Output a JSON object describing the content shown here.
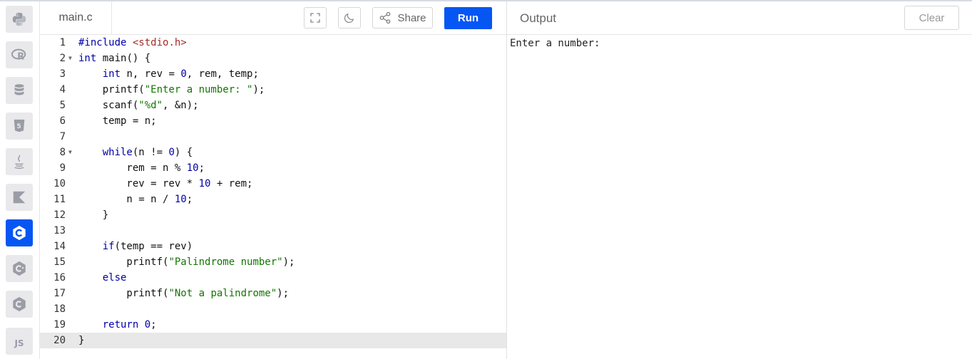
{
  "tab": {
    "filename": "main.c"
  },
  "toolbar": {
    "share_label": "Share",
    "run_label": "Run"
  },
  "output": {
    "title": "Output",
    "clear_label": "Clear",
    "text": "Enter a number:"
  },
  "sidebar": {
    "items": [
      {
        "name": "python-icon"
      },
      {
        "name": "r-icon"
      },
      {
        "name": "sql-icon"
      },
      {
        "name": "html-icon"
      },
      {
        "name": "java-icon"
      },
      {
        "name": "kotlin-icon"
      },
      {
        "name": "c-icon",
        "active": true
      },
      {
        "name": "cpp-icon"
      },
      {
        "name": "csharp-icon"
      },
      {
        "name": "js-icon",
        "label": "JS"
      }
    ],
    "active_color": "#0556f3"
  },
  "editor": {
    "current_line": 20,
    "lines": [
      "#include <stdio.h>",
      "int main() {",
      "    int n, rev = 0, rem, temp;",
      "    printf(\"Enter a number: \");",
      "    scanf(\"%d\", &n);",
      "    temp = n;",
      "",
      "    while(n != 0) {",
      "        rem = n % 10;",
      "        rev = rev * 10 + rem;",
      "        n = n / 10;",
      "    }",
      "",
      "    if(temp == rev)",
      "        printf(\"Palindrome number\");",
      "    else",
      "        printf(\"Not a palindrome\");",
      "",
      "    return 0;",
      "}"
    ],
    "fold_lines": [
      2,
      8
    ]
  }
}
